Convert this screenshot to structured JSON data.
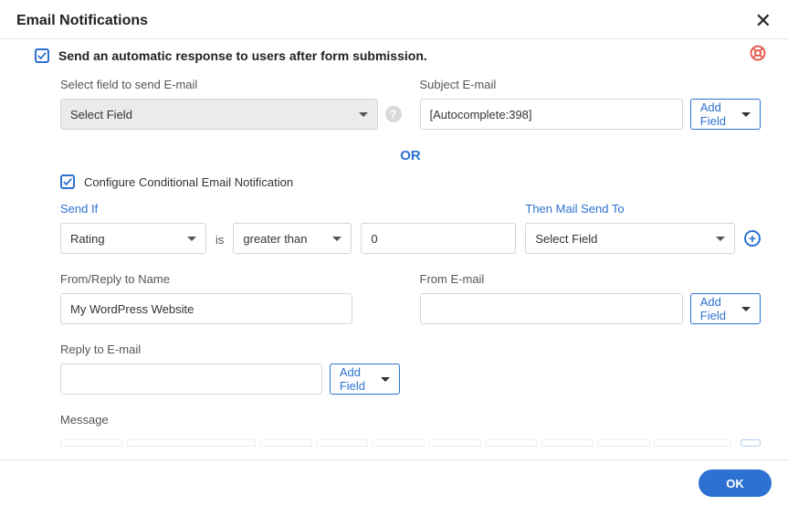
{
  "header": {
    "title": "Email Notifications"
  },
  "main": {
    "auto_response_label": "Send an automatic response to users after form submission.",
    "select_field_label": "Select field to send E-mail",
    "select_field_value": "Select Field",
    "subject_label": "Subject E-mail",
    "subject_value": "[Autocomplete:398]",
    "add_field_label": "Add Field",
    "or_label": "OR",
    "conditional_label": "Configure Conditional Email Notification",
    "send_if_label": "Send If",
    "send_if_field": "Rating",
    "is_label": "is",
    "send_if_operator": "greater than",
    "send_if_value": "0",
    "then_mail_label": "Then Mail Send To",
    "then_mail_value": "Select Field",
    "from_name_label": "From/Reply to Name",
    "from_name_value": "My WordPress Website",
    "from_email_label": "From E-mail",
    "from_email_value": "",
    "reply_email_label": "Reply to E-mail",
    "reply_email_value": "",
    "message_label": "Message"
  },
  "footer": {
    "ok_label": "OK"
  }
}
